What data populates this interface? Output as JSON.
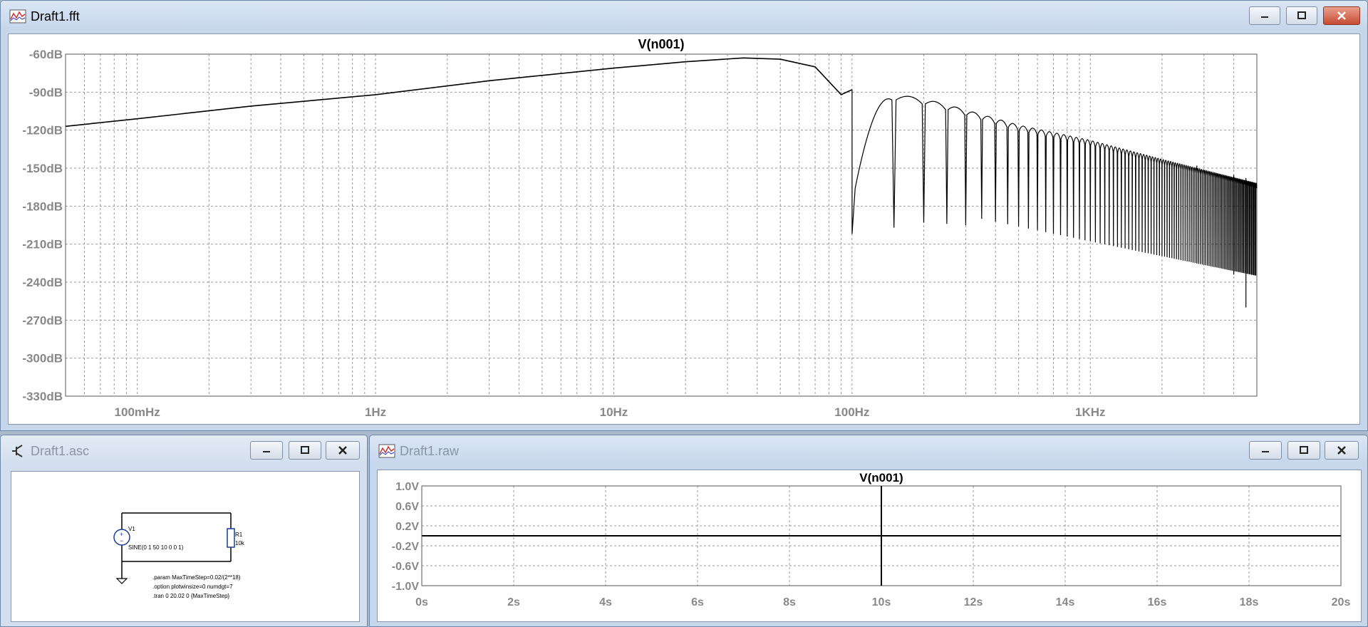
{
  "fft_window": {
    "title": "Draft1.fft",
    "plot_title": "V(n001)",
    "chart_data": {
      "type": "line",
      "title": "V(n001)",
      "x_scale": "log",
      "y_unit": "dB",
      "xlim_hz": [
        0.05,
        5000
      ],
      "ylim_db": [
        -330,
        -60
      ],
      "y_ticks": [
        "-60dB",
        "-90dB",
        "-120dB",
        "-150dB",
        "-180dB",
        "-210dB",
        "-240dB",
        "-270dB",
        "-300dB",
        "-330dB"
      ],
      "x_ticks": [
        "100mHz",
        "1Hz",
        "10Hz",
        "100Hz",
        "1KHz"
      ],
      "series": [
        {
          "envelope_points_hz_db": [
            [
              0.05,
              -117
            ],
            [
              0.1,
              -111
            ],
            [
              0.3,
              -101
            ],
            [
              1,
              -92
            ],
            [
              3,
              -81
            ],
            [
              10,
              -71
            ],
            [
              20,
              -66
            ],
            [
              35,
              -63
            ],
            [
              50,
              -64
            ],
            [
              70,
              -70
            ],
            [
              90,
              -92
            ],
            [
              100,
              -88
            ]
          ],
          "notches_hz_db": [
            [
              100,
              -202
            ],
            [
              150,
              -197
            ],
            [
              200,
              -193
            ],
            [
              250,
              -194
            ],
            [
              300,
              -195
            ],
            [
              2800,
              -225
            ],
            [
              4000,
              -234
            ],
            [
              4500,
              -260
            ]
          ],
          "lobe_peaks_hz_db": [
            [
              120,
              -89
            ],
            [
              175,
              -91
            ],
            [
              220,
              -95
            ],
            [
              300,
              -102
            ],
            [
              500,
              -114
            ],
            [
              1000,
              -126
            ],
            [
              2000,
              -141
            ],
            [
              5000,
              -160
            ]
          ]
        }
      ],
      "grid": true
    }
  },
  "asc_window": {
    "title": "Draft1.asc",
    "schematic": {
      "v1_label": "V1",
      "v1_value": "SINE(0 1 50 10 0 0 1)",
      "r1_label": "R1",
      "r1_value": "10k",
      "directives": [
        ".param MaxTimeStep=0.02/(2**18)",
        ".option plotwinsize=0 numdgt=7",
        ".tran 0 20.02 0 {MaxTimeStep}"
      ]
    }
  },
  "raw_window": {
    "title": "Draft1.raw",
    "plot_title": "V(n001)",
    "chart_data": {
      "type": "line",
      "title": "V(n001)",
      "xlim_s": [
        0,
        20
      ],
      "ylim_v": [
        -1.0,
        1.0
      ],
      "y_ticks": [
        "1.0V",
        "0.6V",
        "0.2V",
        "-0.2V",
        "-0.6V",
        "-1.0V"
      ],
      "x_ticks": [
        "0s",
        "2s",
        "4s",
        "6s",
        "8s",
        "10s",
        "12s",
        "14s",
        "16s",
        "18s",
        "20s"
      ],
      "series": [
        {
          "baseline_v": 0,
          "burst_time_s": 10,
          "burst_min_v": -1.0,
          "burst_max_v": 1.0
        }
      ],
      "grid": true
    }
  }
}
